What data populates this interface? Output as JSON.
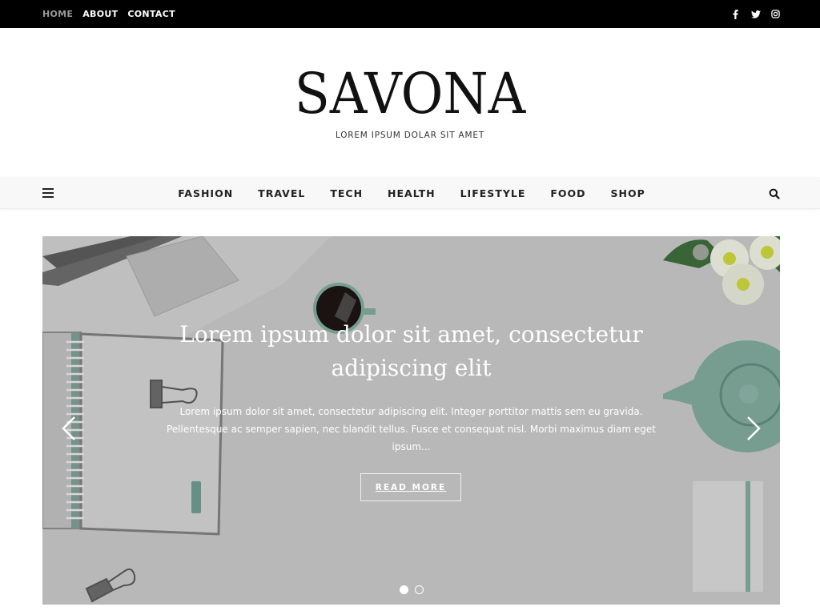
{
  "topbar": {
    "nav": [
      {
        "label": "HOME",
        "active": true
      },
      {
        "label": "ABOUT",
        "active": false
      },
      {
        "label": "CONTACT",
        "active": false
      }
    ],
    "social": [
      "facebook-icon",
      "twitter-icon",
      "instagram-icon"
    ]
  },
  "header": {
    "logo": "SAVONA",
    "tagline": "LOREM IPSUM DOLAR SIT AMET"
  },
  "mainnav": {
    "menu_icon": "hamburger-menu-icon",
    "items": [
      "FASHION",
      "TRAVEL",
      "TECH",
      "HEALTH",
      "LIFESTYLE",
      "FOOD",
      "SHOP"
    ],
    "search_icon": "search-icon"
  },
  "slider": {
    "title": "Lorem ipsum dolor sit amet, consectetur adipiscing elit",
    "excerpt": "Lorem ipsum dolor sit amet, consectetur adipiscing elit. Integer porttitor mattis sem eu gravida. Pellentesque ac semper sapien, nec blandit tellus. Fusce et consequat nisl. Morbi maximus diam eget ipsum...",
    "button_label": "READ MORE",
    "prev_icon": "chevron-left-icon",
    "next_icon": "chevron-right-icon",
    "slide_count": 2,
    "active_slide": 1,
    "colors": {
      "accent_teal": "#7fa79b",
      "background_gray": "#c2c2c2"
    }
  }
}
